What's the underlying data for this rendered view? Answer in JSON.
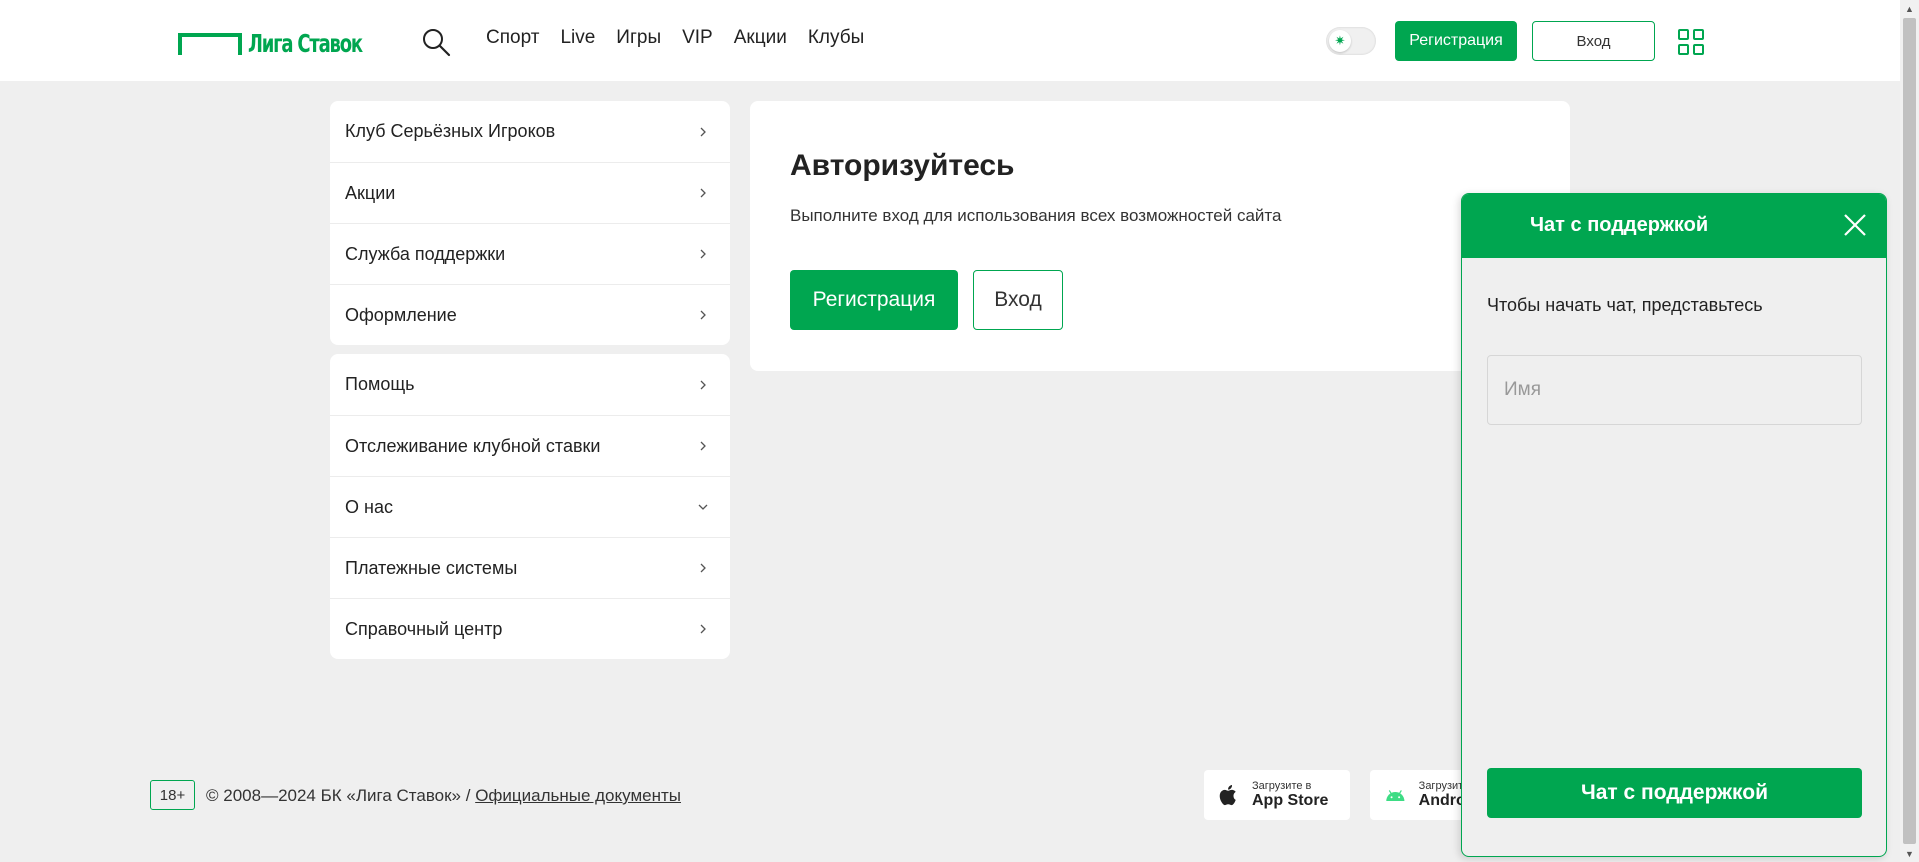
{
  "header": {
    "logo_text": "Лига Ставок",
    "nav": [
      "Спорт",
      "Live",
      "Игры",
      "VIP",
      "Акции",
      "Клубы"
    ],
    "register_label": "Регистрация",
    "login_label": "Вход",
    "theme_icon": "sun-icon"
  },
  "menu_top": [
    {
      "label": "Клуб Серьёзных Игроков",
      "chevron": "right"
    },
    {
      "label": "Акции",
      "chevron": "right"
    },
    {
      "label": "Служба поддержки",
      "chevron": "right"
    },
    {
      "label": "Оформление",
      "chevron": "right"
    }
  ],
  "menu_bottom": [
    {
      "label": "Помощь",
      "chevron": "right"
    },
    {
      "label": "Отслеживание клубной ставки",
      "chevron": "right"
    },
    {
      "label": "О нас",
      "chevron": "down"
    },
    {
      "label": "Платежные системы",
      "chevron": "right"
    },
    {
      "label": "Справочный центр",
      "chevron": "right"
    }
  ],
  "auth": {
    "title": "Авторизуйтесь",
    "subtitle": "Выполните вход для использования всех возможностей сайта",
    "register_label": "Регистрация",
    "login_label": "Вход"
  },
  "footer": {
    "age": "18+",
    "copyright": "© 2008—2024 БК «Лига Ставок» / ",
    "docs_link": "Официальные документы",
    "appstore_small": "Загрузите в",
    "appstore_big": "App Store",
    "android_small": "Загрузите",
    "android_big": "Android"
  },
  "chat": {
    "title": "Чат с поддержкой",
    "intro": "Чтобы начать чат, представьтесь",
    "name_placeholder": "Имя",
    "name_value": "",
    "button_label": "Чат с поддержкой"
  },
  "colors": {
    "brand": "#00a650",
    "background": "#efefef"
  }
}
